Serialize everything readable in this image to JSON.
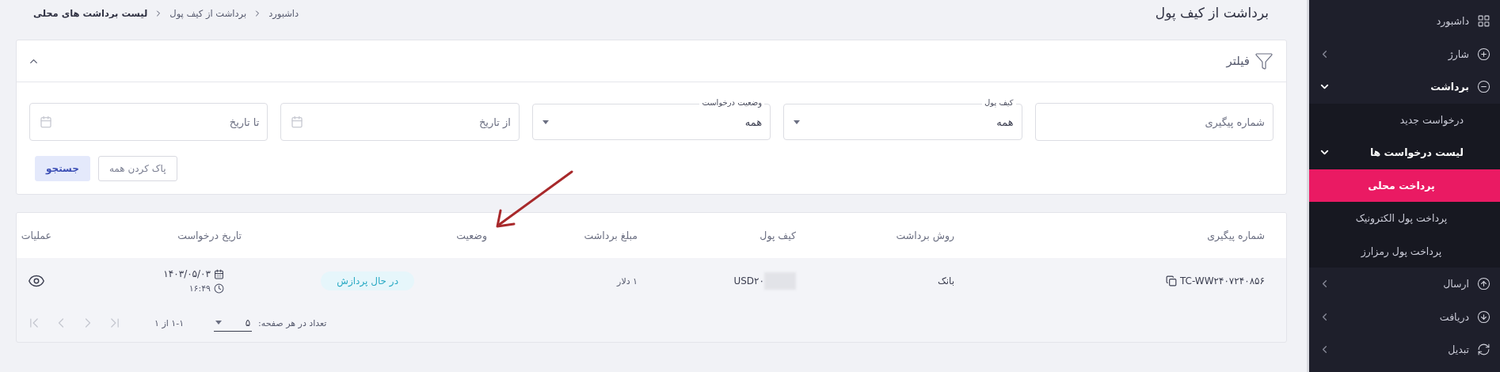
{
  "page": {
    "title": "برداشت از کیف پول",
    "breadcrumbs": [
      {
        "label": "داشبورد"
      },
      {
        "label": "برداشت از کیف پول"
      },
      {
        "label": "لیست برداشت های محلی"
      }
    ]
  },
  "filter": {
    "title": "فیلتر",
    "expanded": true,
    "fields": [
      {
        "kind": "text",
        "placeholder": "شماره پیگیری"
      },
      {
        "kind": "select",
        "label": "کیف پول",
        "value": "همه"
      },
      {
        "kind": "select",
        "label": "وضعیت درخواست",
        "value": "همه"
      },
      {
        "kind": "date",
        "placeholder": "از تاریخ"
      },
      {
        "kind": "date",
        "placeholder": "تا تاریخ"
      }
    ],
    "buttons": [
      {
        "kind": "outline",
        "label": "پاک کردن همه"
      },
      {
        "kind": "primary",
        "label": "جستجو"
      }
    ]
  },
  "table": {
    "columns": [
      "شماره پیگیری",
      "روش برداشت",
      "کیف پول",
      "مبلغ برداشت",
      "وضعیت",
      "تاریخ درخواست",
      "عملیات"
    ],
    "rows": [
      {
        "tracking": "TC-WW۲۴۰۷۲۴۰۸۵۶",
        "method": "بانک",
        "wallet": "USD۲۰",
        "wallet_redacted": true,
        "amount": "۱ دلار",
        "status": "در حال پردازش",
        "date": "۱۴۰۳/۰۵/۰۳",
        "time": "۱۶:۴۹"
      }
    ]
  },
  "pagination": {
    "per_page_label": "تعداد در هر صفحه:",
    "per_page": "۵",
    "range": "۱-۱ از ۱",
    "buttons": [
      {
        "disabled": true
      },
      {
        "disabled": true
      },
      {
        "disabled": true
      },
      {
        "disabled": true
      }
    ]
  },
  "sidebar": {
    "items": [
      {
        "label": "داشبورد",
        "selected": false
      },
      {
        "label": "شارژ",
        "expanded": false,
        "selected": false
      },
      {
        "label": "برداشت",
        "expanded": true,
        "selected": false,
        "children": [
          {
            "label": "درخواست جدید",
            "selected": false
          },
          {
            "label": "لیست درخواست ها",
            "expanded": true,
            "selected": false,
            "children": [
              {
                "label": "پرداخت محلی",
                "selected": true
              },
              {
                "label": "پرداخت پول الکترونیک",
                "selected": false
              },
              {
                "label": "پرداخت پول رمزارز",
                "selected": false
              }
            ]
          }
        ]
      },
      {
        "label": "ارسال",
        "expanded": false,
        "selected": false
      },
      {
        "label": "دریافت",
        "expanded": false,
        "selected": false
      },
      {
        "label": "تبدیل",
        "expanded": false,
        "selected": false
      }
    ]
  }
}
